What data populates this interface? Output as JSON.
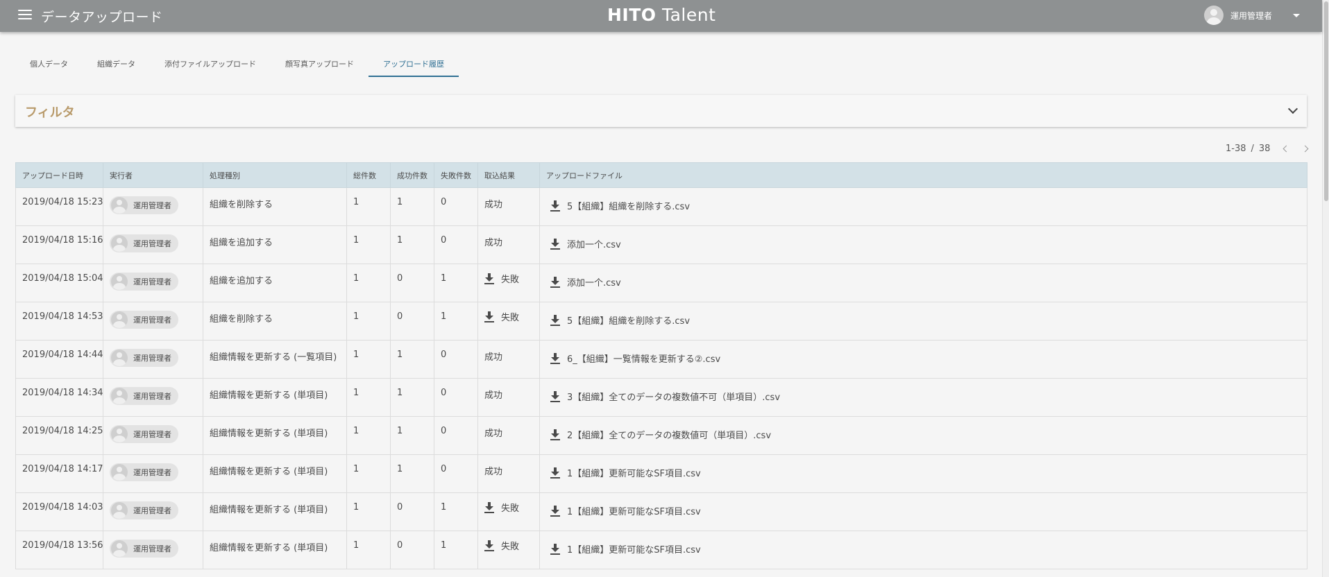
{
  "header": {
    "title": "データアップロード",
    "brand_strong": "HITO",
    "brand_light": "Talent",
    "user_name": "運用管理者"
  },
  "tabs": [
    {
      "label": "個人データ",
      "active": false
    },
    {
      "label": "組織データ",
      "active": false
    },
    {
      "label": "添付ファイルアップロード",
      "active": false
    },
    {
      "label": "顔写真アップロード",
      "active": false
    },
    {
      "label": "アップロード履歴",
      "active": true
    }
  ],
  "filter": {
    "title": "フィルタ"
  },
  "pagination": {
    "range": "1-38",
    "separator": "/",
    "total": "38"
  },
  "table": {
    "columns": [
      "アップロード日時",
      "実行者",
      "処理種別",
      "総件数",
      "成功件数",
      "失敗件数",
      "取込結果",
      "アップロードファイル"
    ],
    "rows": [
      {
        "datetime": "2019/04/18 15:23",
        "user": "運用管理者",
        "type": "組織を削除する",
        "total": "1",
        "success": "1",
        "failed": "0",
        "result": "成功",
        "result_failed": false,
        "file": "5【組織】組織を削除する.csv"
      },
      {
        "datetime": "2019/04/18 15:16",
        "user": "運用管理者",
        "type": "組織を追加する",
        "total": "1",
        "success": "1",
        "failed": "0",
        "result": "成功",
        "result_failed": false,
        "file": "添加一个.csv"
      },
      {
        "datetime": "2019/04/18 15:04",
        "user": "運用管理者",
        "type": "組織を追加する",
        "total": "1",
        "success": "0",
        "failed": "1",
        "result": "失敗",
        "result_failed": true,
        "file": "添加一个.csv"
      },
      {
        "datetime": "2019/04/18 14:53",
        "user": "運用管理者",
        "type": "組織を削除する",
        "total": "1",
        "success": "0",
        "failed": "1",
        "result": "失敗",
        "result_failed": true,
        "file": "5【組織】組織を削除する.csv"
      },
      {
        "datetime": "2019/04/18 14:44",
        "user": "運用管理者",
        "type": "組織情報を更新する (一覧項目)",
        "total": "1",
        "success": "1",
        "failed": "0",
        "result": "成功",
        "result_failed": false,
        "file": "6_【組織】一覧情報を更新する②.csv"
      },
      {
        "datetime": "2019/04/18 14:34",
        "user": "運用管理者",
        "type": "組織情報を更新する (単項目)",
        "total": "1",
        "success": "1",
        "failed": "0",
        "result": "成功",
        "result_failed": false,
        "file": "3【組織】全てのデータの複数値不可（単項目）.csv"
      },
      {
        "datetime": "2019/04/18 14:25",
        "user": "運用管理者",
        "type": "組織情報を更新する (単項目)",
        "total": "1",
        "success": "1",
        "failed": "0",
        "result": "成功",
        "result_failed": false,
        "file": "2【組織】全てのデータの複数値可（単項目）.csv"
      },
      {
        "datetime": "2019/04/18 14:17",
        "user": "運用管理者",
        "type": "組織情報を更新する (単項目)",
        "total": "1",
        "success": "1",
        "failed": "0",
        "result": "成功",
        "result_failed": false,
        "file": "1【組織】更新可能なSF項目.csv"
      },
      {
        "datetime": "2019/04/18 14:03",
        "user": "運用管理者",
        "type": "組織情報を更新する (単項目)",
        "total": "1",
        "success": "0",
        "failed": "1",
        "result": "失敗",
        "result_failed": true,
        "file": "1【組織】更新可能なSF項目.csv"
      },
      {
        "datetime": "2019/04/18 13:56",
        "user": "運用管理者",
        "type": "組織情報を更新する (単項目)",
        "total": "1",
        "success": "0",
        "failed": "1",
        "result": "失敗",
        "result_failed": true,
        "file": "1【組織】更新可能なSF項目.csv"
      }
    ]
  },
  "colors": {
    "appbar": "#8e9192",
    "tab_active": "#2f6f93",
    "filter_title": "#b89a6a",
    "table_header": "#d3e1e7"
  }
}
